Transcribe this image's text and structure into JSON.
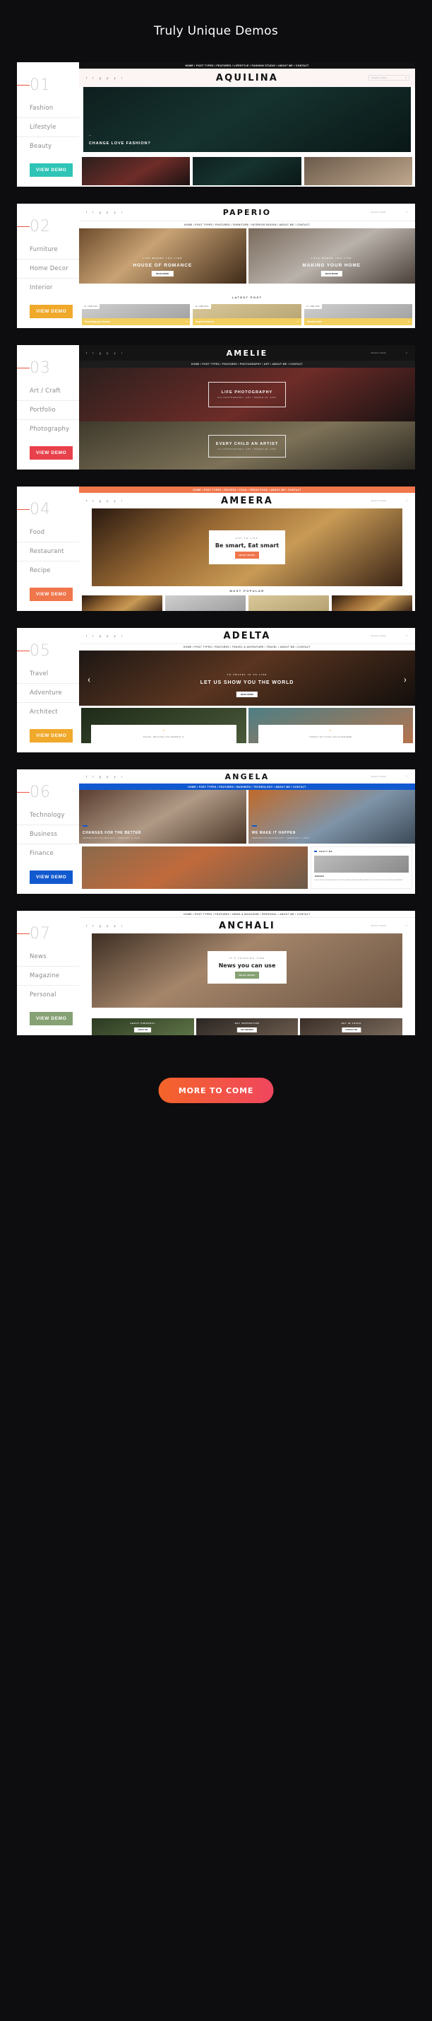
{
  "page": {
    "title": "Truly Unique Demos",
    "background_color": "#0d0d0f",
    "more_button": "MORE TO COME",
    "accent_line_color": "#e8553c"
  },
  "demos": [
    {
      "number": "01",
      "brand": "AQUILINA",
      "tags": [
        "Fashion",
        "Lifestyle",
        "Beauty"
      ],
      "button": "VIEW DEMO",
      "button_color": "#2ec5b6",
      "nav": "HOME  /  POST TYPES  /  FEATURES  /  LIFESTYLE  /  FASHION STUDIO  /  ABOUT ME  /  CONTACT",
      "search_placeholder": "SEARCH HERE...",
      "hero_kicker": "—",
      "hero_title": "CHANGE LOVE FASHION?",
      "thumbs": [
        "fashion-thumb-1",
        "fashion-thumb-2",
        "fashion-thumb-3"
      ]
    },
    {
      "number": "02",
      "brand": "PAPERIO",
      "tags": [
        "Furniture",
        "Home Decor",
        "Interior"
      ],
      "button": "VIEW DEMO",
      "button_color": "#f0a92b",
      "nav": "HOME  /  POST TYPES  /  FEATURES  /  FURNITURE  /  INTERIOR DESIGN  /  ABOUT ME  /  CONTACT",
      "search_placeholder": "SEARCH HERE...",
      "hero_left_kicker": "LIVE WHERE YOU LIKE",
      "hero_left_title": "HOUSE OF ROMANCE",
      "hero_right_kicker": "LOVE MAKES YOU LIVE",
      "hero_right_title": "MAKING YOUR HOME",
      "read_more": "READ MORE",
      "section_label": "LATEST POST",
      "posts": [
        {
          "date": "12 / FEB 2016",
          "title": "Furnishing your dreams"
        },
        {
          "date": "12 / FEB 2016",
          "title": "Inspired interiors"
        },
        {
          "date": "12 / FEB 2016",
          "title": "Homely haven"
        }
      ]
    },
    {
      "number": "03",
      "brand": "AMELIE",
      "tags": [
        "Art / Craft",
        "Portfolio",
        "Photography"
      ],
      "button": "VIEW DEMO",
      "button_color": "#e8414b",
      "nav": "HOME  /  POST TYPES  /  FEATURES  /  PHOTOGRAPHY  /  ART  /  ABOUT ME  /  CONTACT",
      "search_placeholder": "SEARCH HERE...",
      "slide1_title": "LIFE PHOTOGRAPHY",
      "slide1_meta": "ALL PHOTOGRAPHY, ART / MARCH 28, 2016",
      "slide2_title": "EVERY CHILD AN ARTIST",
      "slide2_meta": "ALL PHOTOGRAPHY, ART / MARCH 28, 2016"
    },
    {
      "number": "04",
      "brand": "AMEERA",
      "tags": [
        "Food",
        "Restaurant",
        "Recipe"
      ],
      "button": "VIEW DEMO",
      "button_color": "#f0764c",
      "nav": "HOME  /  POST TYPES  /  RECIPES  /  FOOD  /  FRESH FOOD  /  ABOUT ME  /  CONTACT",
      "search_placeholder": "SEARCH HERE...",
      "card_kicker": "EAT TO LIVE",
      "card_title": "Be smart, Eat smart",
      "read_more": "READ MORE",
      "section_label": "MOST POPULAR"
    },
    {
      "number": "05",
      "brand": "ADELTA",
      "tags": [
        "Travel",
        "Adventure",
        "Architect"
      ],
      "button": "VIEW DEMO",
      "button_color": "#f0a92b",
      "nav": "HOME  /  POST TYPES  /  FEATURES  /  TRAVEL & ADVENTURE  /  TRAVEL  /  ABOUT ME  /  CONTACT",
      "search_placeholder": "SEARCH HERE...",
      "hero_kicker": "TO TRAVEL IS TO LIVE",
      "hero_title": "LET US SHOW YOU THE WORLD",
      "read_more": "READ MORE",
      "quotes": [
        {
          "mark": "“",
          "text": "TRAVEL, BECAUSE LIFE DESERVE IT"
        },
        {
          "mark": "“",
          "text": "THERE'S NO PLACE LIKE ELSEWHERE"
        }
      ]
    },
    {
      "number": "06",
      "brand": "ANGELA",
      "tags": [
        "Technology",
        "Business",
        "Finance"
      ],
      "button": "VIEW DEMO",
      "button_color": "#1159cf",
      "nav": "HOME  /  POST TYPES  /  FEATURES  /  BUSINESS  /  TECHNOLOGY  /  ABOUT ME  /  CONTACT",
      "search_placeholder": "SEARCH HERE...",
      "post_left_title": "CHANGES FOR THE BETTER",
      "post_left_meta": "INSPIRATION TECHNOLOGY / FEBRUARY 2, 2016",
      "post_right_title": "WE MAKE IT HAPPEN",
      "post_right_meta": "INSPIRATION TECHNOLOGY / FEBRUARY 2, 2016",
      "about_label": "ABOUT ME",
      "about_name": "JOHN DEO",
      "about_text": "Lorem Ipsum is simply dummy text of the printing and typesetting industry. Lorem Ipsum has been industry's standard."
    },
    {
      "number": "07",
      "brand": "ANCHALI",
      "tags": [
        "News",
        "Magazine",
        "Personal"
      ],
      "button": "VIEW DEMO",
      "button_color": "#86a173",
      "nav": "HOME  /  POST TYPES  /  FEATURES  /  NEWS & MAGAZINE  /  PERSONAL  /  ABOUT ME  /  CONTACT",
      "search_placeholder": "SEARCH HERE...",
      "card_kicker": "IT'S THINKING TIME",
      "card_title": "News you can use",
      "read_more": "READ MORE",
      "tiles": [
        {
          "kicker": "ABOUT PERSONAL",
          "button": "ABOUT ME"
        },
        {
          "kicker": "GET INSPIRATION",
          "button": "GET INSPIRED"
        },
        {
          "kicker": "GET IN TOUCH",
          "button": "CONTACT ME"
        }
      ]
    }
  ]
}
